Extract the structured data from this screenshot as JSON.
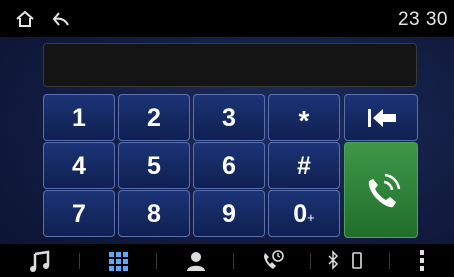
{
  "status_bar": {
    "time": "23 30",
    "icons": [
      "home-icon",
      "back-icon"
    ]
  },
  "dialer": {
    "number_display": "",
    "keys": [
      {
        "label": "1"
      },
      {
        "label": "2"
      },
      {
        "label": "3"
      },
      {
        "label": "*"
      },
      {
        "label": "4"
      },
      {
        "label": "5"
      },
      {
        "label": "6"
      },
      {
        "label": "#"
      },
      {
        "label": "7"
      },
      {
        "label": "8"
      },
      {
        "label": "9"
      },
      {
        "label": "0",
        "sub": "+"
      }
    ],
    "backspace_icon": "backspace-icon",
    "call_icon": "phone-call-icon",
    "colors": {
      "keypad": "#152a63",
      "call": "#2e8139",
      "background": "#111c40"
    }
  },
  "nav_bar": {
    "items": [
      "music-icon",
      "apps-grid-icon",
      "contacts-icon",
      "call-history-icon",
      "bluetooth-icon",
      "phone-device-icon",
      "more-icon"
    ]
  }
}
